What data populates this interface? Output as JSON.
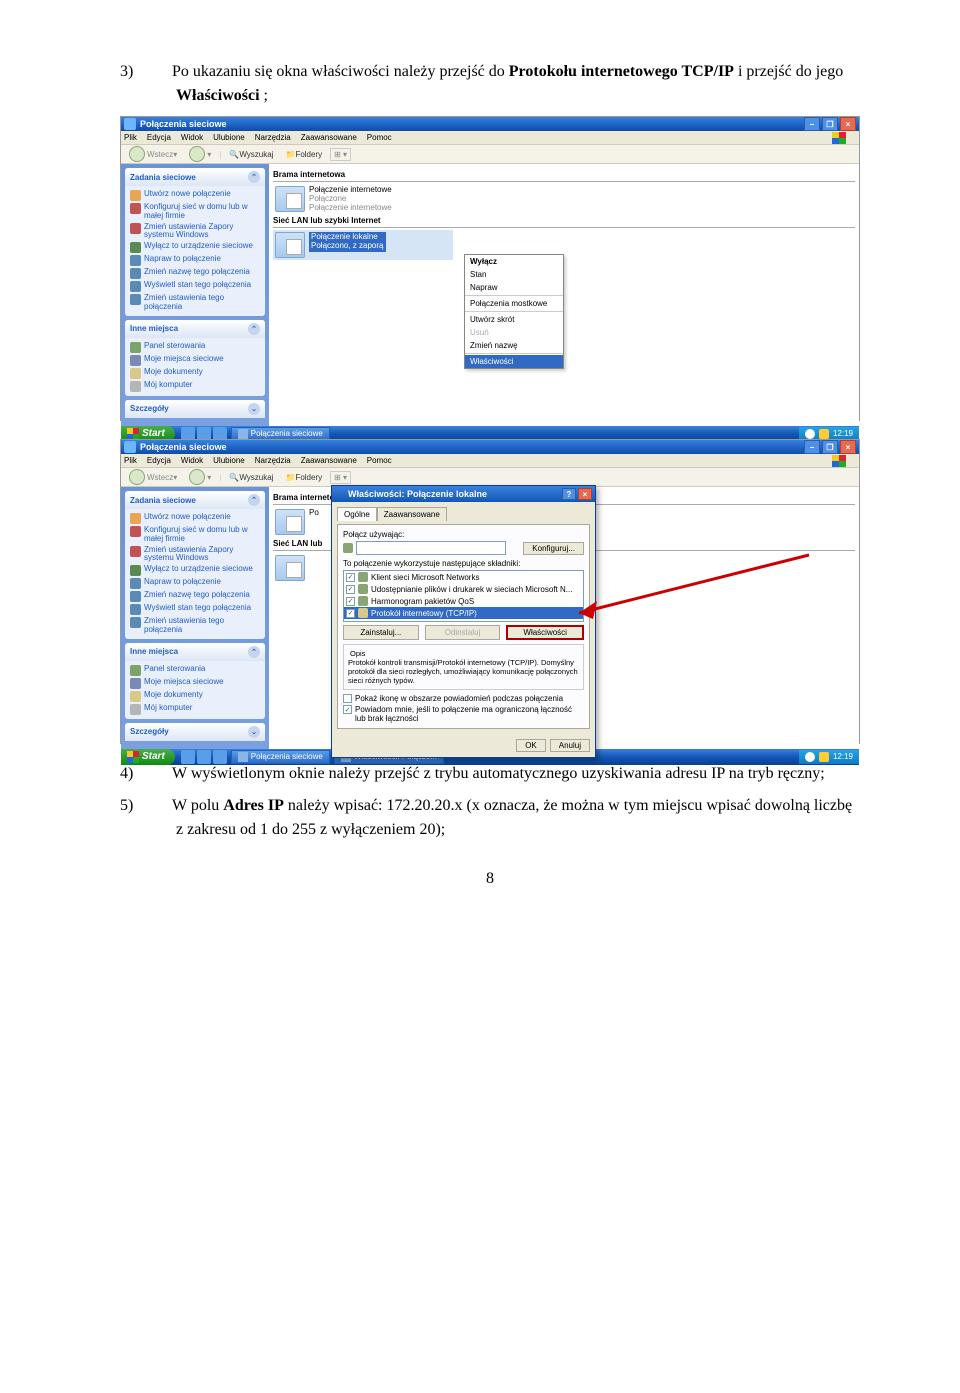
{
  "doc": {
    "step3_num": "3)",
    "step3_text_before": "Po ukazaniu się okna właściwości należy przejść do ",
    "step3_bold1": "Protokołu internetowego TCP/IP",
    "step3_text_mid": " i przejść do jego ",
    "step3_bold2": "Właściwości",
    "step3_text_after": " ;",
    "step4_num": "4)",
    "step4_text": "W wyświetlonym oknie należy przejść z trybu automatycznego uzyskiwania adresu IP na tryb ręczny;",
    "step5_num": "5)",
    "step5_text_before": "W polu ",
    "step5_bold": "Adres IP",
    "step5_text_after": " należy wpisać: 172.20.20.x (x oznacza, że można w tym miejscu wpisać dowolną liczbę z zakresu od 1 do 255 z wyłączeniem 20);",
    "page_num": "8"
  },
  "shared_window": {
    "title": "Połączenia sieciowe",
    "menu": [
      "Plik",
      "Edycja",
      "Widok",
      "Ulubione",
      "Narzędzia",
      "Zaawansowane",
      "Pomoc"
    ],
    "toolbar": {
      "back": "Wstecz",
      "search": "Wyszukaj",
      "folders": "Foldery"
    },
    "taskbar": {
      "start": "Start",
      "time": "12:19"
    }
  },
  "left_panel": {
    "tasks_header": "Zadania sieciowe",
    "tasks": [
      "Utwórz nowe połączenie",
      "Konfiguruj sieć w domu lub w małej firmie",
      "Zmień ustawienia Zapory systemu Windows",
      "Wyłącz to urządzenie sieciowe",
      "Napraw to połączenie",
      "Zmień nazwę tego połączenia",
      "Wyświetl stan tego połączenia",
      "Zmień ustawienia tego połączenia"
    ],
    "other_header": "Inne miejsca",
    "other": [
      "Panel sterowania",
      "Moje miejsca sieciowe",
      "Moje dokumenty",
      "Mój komputer"
    ],
    "details_header": "Szczegóły"
  },
  "s1": {
    "section1": "Brama internetowa",
    "conn1_name": "Połączenie internetowe",
    "conn1_status": "Połączone",
    "conn1_subtitle": "Połączenie internetowe",
    "section2": "Sieć LAN lub szybki Internet",
    "conn2_name": "Połączenie lokalne",
    "conn2_status": "Połączono, z zaporą",
    "ctx_menu": {
      "items": [
        {
          "label": "Wyłącz",
          "type": "bold"
        },
        {
          "label": "Stan",
          "type": "normal"
        },
        {
          "label": "Napraw",
          "type": "normal"
        },
        {
          "sep": true
        },
        {
          "label": "Połączenia mostkowe",
          "type": "normal"
        },
        {
          "sep": true
        },
        {
          "label": "Utwórz skrót",
          "type": "normal"
        },
        {
          "label": "Usuń",
          "type": "disabled"
        },
        {
          "label": "Zmień nazwę",
          "type": "normal"
        },
        {
          "sep": true
        },
        {
          "label": "Właściwości",
          "type": "highlight"
        }
      ]
    },
    "taskbar_btn": "Połączenia sieciowe"
  },
  "s2": {
    "dialog_title": "Właściwości: Połączenie lokalne",
    "tab1": "Ogólne",
    "tab2": "Zaawansowane",
    "connect_using": "Połącz używając:",
    "configure_btn": "Konfiguruj...",
    "components_label": "To połączenie wykorzystuje następujące składniki:",
    "components": [
      {
        "checked": true,
        "label": "Klient sieci Microsoft Networks"
      },
      {
        "checked": true,
        "label": "Udostępnianie plików i drukarek w sieciach Microsoft N..."
      },
      {
        "checked": true,
        "label": "Harmonogram pakietów QoS"
      },
      {
        "checked": true,
        "label": "Protokół internetowy (TCP/IP)",
        "sel": true
      }
    ],
    "install_btn": "Zainstaluj...",
    "uninstall_btn": "Odinstaluj",
    "properties_btn": "Właściwości",
    "desc_header": "Opis",
    "desc_text": "Protokół kontroli transmisji/Protokół internetowy (TCP/IP). Domyślny protokół dla sieci rozległych, umożliwiający komunikację połączonych sieci różnych typów.",
    "chk_show_icon": "Pokaż ikonę w obszarze powiadomień podczas połączenia",
    "chk_notify": "Powiadom mnie, jeśli to połączenie ma ograniczoną łączność lub brak łączności",
    "ok": "OK",
    "cancel": "Anuluj",
    "taskbar_btn1": "Połączenia sieciowe",
    "taskbar_btn2": "Właściwości: Połącze...",
    "time": "12:19",
    "section1": "Brama internetowa",
    "conn1_name_trimmed": "Po",
    "section2_trimmed": "Sieć LAN lub"
  }
}
